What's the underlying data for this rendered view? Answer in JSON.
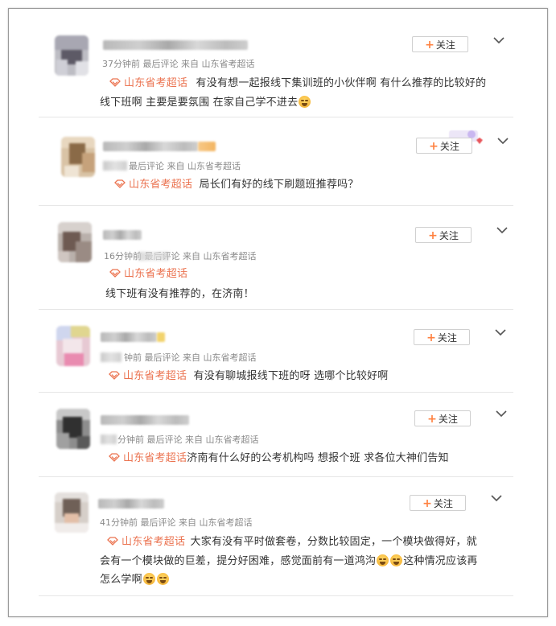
{
  "follow_label": "关注",
  "colors": {
    "accent": "#eb7350",
    "plus": "#ff8140",
    "meta": "#8a8a8a"
  },
  "icons": {
    "topic": "super-topic-icon",
    "menu": "chevron-down-icon",
    "emoji": "crying-emoji-icon"
  },
  "posts": [
    {
      "meta": "37分钟前 最后评论 来自 山东省考超话",
      "topic": "山东省考超话",
      "line1": "有没有想一起报线下集训班的小伙伴啊 有什么推荐的比较好的",
      "line2": "线下班啊 主要是要氛围 在家自己学不进去"
    },
    {
      "meta": "最后评论 来自 山东省考超话",
      "topic": "山东省考超话",
      "line1": "局长们有好的线下刷题班推荐吗？"
    },
    {
      "meta": "16分钟前 最后评论 来自 山东省考超话",
      "topic": "山东省考超话",
      "line1": "线下班有没有推荐的，在济南！"
    },
    {
      "meta": "钟前 最后评论 来自 山东省考超话",
      "topic": "山东省考超话",
      "line1": "有没有聊城报线下班的呀 选哪个比较好啊"
    },
    {
      "meta": "分钟前 最后评论 来自 山东省考超话",
      "topic": "山东省考超话",
      "line1": "济南有什么好的公考机构吗 想报个班 求各位大神们告知"
    },
    {
      "meta": "41分钟前 最后评论 来自 山东省考超话",
      "topic": "山东省考超话",
      "line1": "大家有没有平时做套卷，分数比较固定，一个模块做得好，就",
      "line2a": "会有一个模块做的巨差，提分好困难，感觉面前有一道鸿沟",
      "line2b": "这种情况应该再",
      "line3": "怎么学啊"
    }
  ]
}
